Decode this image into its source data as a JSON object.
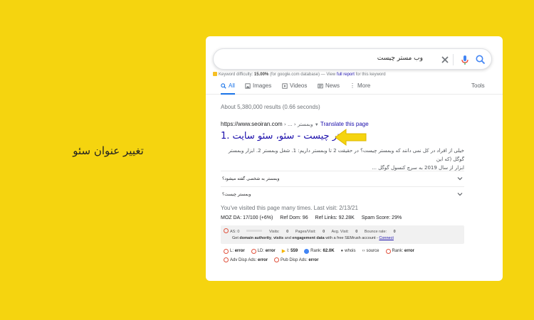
{
  "side_caption": "تغییر عنوان سئو",
  "search": {
    "query": "وب مستر چیست"
  },
  "keyword_line": {
    "label": "Keyword difficulty:",
    "value": "15.00%",
    "source": "(for google.com database) — View",
    "link": "full report",
    "suffix": "for this keyword"
  },
  "tabs": [
    {
      "label": "All",
      "icon": "search-icon"
    },
    {
      "label": "Images",
      "icon": "image-icon"
    },
    {
      "label": "Videos",
      "icon": "video-icon"
    },
    {
      "label": "News",
      "icon": "news-icon"
    },
    {
      "label": "More",
      "icon": "more-vert-icon"
    },
    {
      "label": "Tools"
    }
  ],
  "result_count": "About 5,380,000 results (0.66 seconds)",
  "result": {
    "url": "https://www.seoiran.com",
    "crumb": "› ... › وبمستر",
    "translate": "Translate this page",
    "title": "وبمستر چیست - سئو، سئو سایت .1",
    "snippet_line1": "خیلی از افراد در کل نمی دانند که وبمستر چیست؟ در حقیقت 2 تا وبمستر داریم: 1. شغل وبمستر 2. ابزار وبمستر گوگل (که این",
    "snippet_line2": "ابزار از سال 2019 به سرچ کنسول گوگل ..."
  },
  "questions": [
    "وبمستر به شخصی گفته میشود؟",
    "وبمستر چیست؟"
  ],
  "visited": "You've visited this page many times. Last visit: 2/13/21",
  "moz": {
    "da": "MOZ DA: 17/100 (+6%)",
    "ref_dom": "Ref Dom: 96",
    "ref_links": "Ref Links: 92.28K",
    "spam": "Spam Score: 29%"
  },
  "semrush": {
    "as": "AS: 0",
    "visits_label": "Visits:",
    "visits": "0",
    "pages_label": "Pages/Visit:",
    "pages": "0",
    "avg_label": "Avg. Visit:",
    "avg": "0",
    "bounce_label": "Bounce rate:",
    "bounce": "0",
    "get": "Get",
    "da_text": "domain authority",
    "comma": ",",
    "visits_text": "visits",
    "and": "and",
    "engagement": "engagement data",
    "with": "with a free SEMrush account -",
    "connect": "Connect"
  },
  "seoquake_row1": {
    "l_label": "L:",
    "l_val": "error",
    "ld_label": "LD:",
    "ld_val": "error",
    "i_label": "I:",
    "i_val": "559",
    "rank_label": "Rank:",
    "rank_val": "62.0K",
    "whois": "whois",
    "source": "source",
    "rank2_label": "Rank:",
    "rank2_val": "error"
  },
  "seoquake_row2": {
    "adv_label": "Adv Disp Ads:",
    "adv_val": "error",
    "pub_label": "Pub Disp Ads:",
    "pub_val": "error"
  },
  "colors": {
    "background": "#f5d40f",
    "link": "#1a0dab",
    "accent": "#1a73e8",
    "arrow": "#f5d40f"
  }
}
